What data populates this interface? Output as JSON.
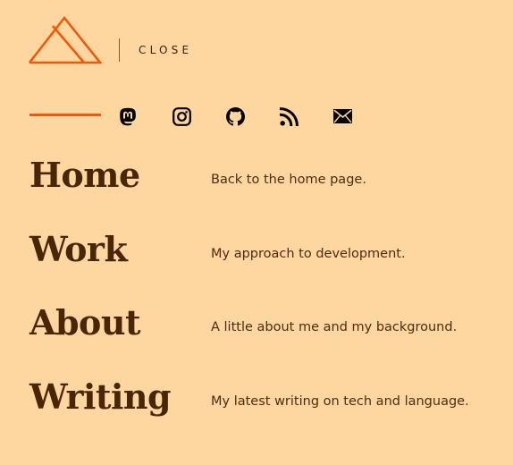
{
  "header": {
    "logo": "mountain-triangle-logo",
    "close_label": "CLOSE"
  },
  "social": [
    {
      "icon": "mastodon-icon"
    },
    {
      "icon": "instagram-icon"
    },
    {
      "icon": "github-icon"
    },
    {
      "icon": "rss-icon"
    },
    {
      "icon": "mail-icon"
    }
  ],
  "nav": {
    "items": [
      {
        "label": "Home",
        "description": "Back to the home page."
      },
      {
        "label": "Work",
        "description": "My approach to development."
      },
      {
        "label": "About",
        "description": "A little about me and my background."
      },
      {
        "label": "Writing",
        "description": "My latest writing on tech and language."
      }
    ]
  },
  "colors": {
    "background": "#fed6a0",
    "accent": "#f0590a",
    "text": "#4a2608"
  }
}
